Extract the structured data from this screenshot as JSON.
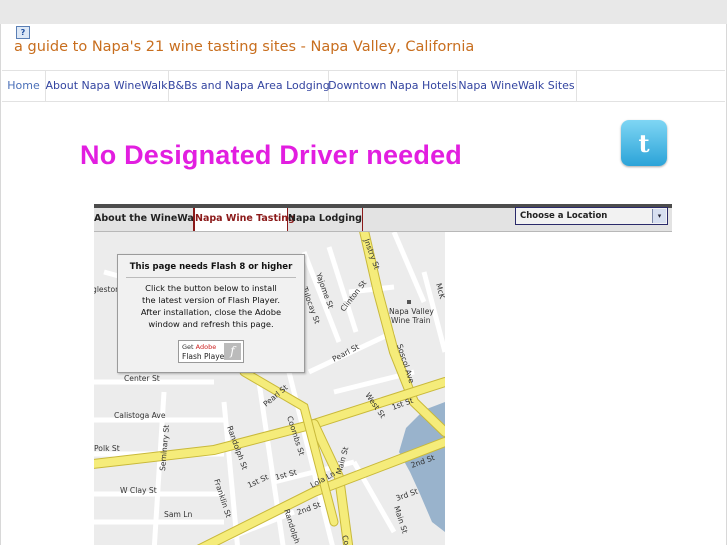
{
  "site": {
    "broken_image_glyph": "?",
    "title": "a guide to Napa's 21 wine tasting sites - Napa Valley, California"
  },
  "nav": [
    {
      "label": "Home"
    },
    {
      "label": "About Napa WineWalk"
    },
    {
      "label": "B&Bs and Napa Area Lodging"
    },
    {
      "label": "Downtown Napa Hotels"
    },
    {
      "label": "Napa WineWalk Sites"
    }
  ],
  "banner": {
    "text": "No Designated Driver needed"
  },
  "twitter": {
    "glyph": "t"
  },
  "map_widget": {
    "tabs": [
      {
        "label": "About the WineWalk"
      },
      {
        "label": "Napa Wine Tasting",
        "active": true
      },
      {
        "label": "Napa Lodging"
      }
    ],
    "location_select": {
      "value": "Choose a Location"
    },
    "flash_notice": {
      "title": "This page needs Flash 8 or higher",
      "lines": [
        "Click the button below to install",
        "the latest version of Flash Player.",
        "After installation, close the Adobe",
        "window and refresh this page."
      ],
      "button": {
        "get": "Get",
        "adobe": "Adobe",
        "product": "Flash Player",
        "logo_glyph": "f"
      }
    },
    "map_labels": {
      "yajome": "Yajome St",
      "tulocay": "Tulocay St",
      "clinton": "Clinton St",
      "napa_valley": "Napa Valley",
      "wine_train": "Wine Train",
      "soscol": "Soscol Ave",
      "pearl_east": "Pearl St",
      "pearl_west": "Pearl St",
      "west": "West St",
      "first_east": "1st St",
      "first_mid": "1st St",
      "first_west": "1st St",
      "main": "Main St",
      "coombs": "Coombs St",
      "randolph_north": "Randolph St",
      "randolph_south": "Randolph St",
      "franklin": "Franklin St",
      "seminary": "Seminary St",
      "center": "Center St",
      "calistoga": "Calistoga Ave",
      "polk": "Polk St",
      "clay": "W Clay St",
      "sam": "Sam Ln",
      "lola": "Lola Ln",
      "second_mid": "2nd St",
      "second_east": "2nd St",
      "third_east": "3rd St",
      "glestor": "glestor",
      "jnstry": "Jnstry St",
      "mck": "McK",
      "co": "Co"
    }
  }
}
